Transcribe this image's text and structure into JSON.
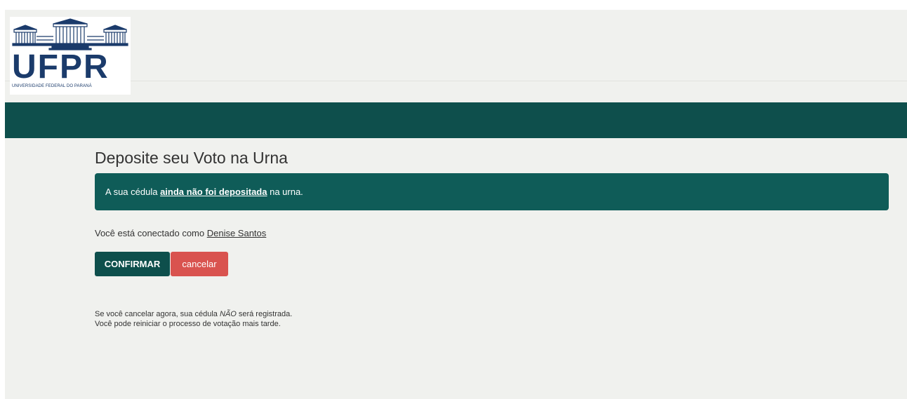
{
  "header": {
    "logo_name": "UFPR",
    "logo_subtitle": "UNIVERSIDADE FEDERAL DO PARANÁ"
  },
  "main": {
    "title": "Deposite seu Voto na Urna",
    "alert": {
      "prefix": "A sua cédula ",
      "highlight": "ainda não foi depositada",
      "suffix": " na urna."
    },
    "connected": {
      "prefix": "Você está conectado como ",
      "user": "Denise Santos"
    },
    "buttons": {
      "confirm_label": "CONFIRMAR",
      "cancel_label": "cancelar"
    },
    "note": {
      "line1_prefix": "Se você cancelar agora, sua cédula ",
      "line1_emphasis": "NÃO",
      "line1_suffix": " será registrada.",
      "line2": "Você pode reiniciar o processo de votação mais tarde."
    }
  },
  "colors": {
    "brand_dark": "#0e4f4c",
    "alert_bg": "#0f5c58",
    "cancel": "#d9534f",
    "page_bg": "#f0f1ee",
    "logo_blue": "#1b3b6b"
  }
}
